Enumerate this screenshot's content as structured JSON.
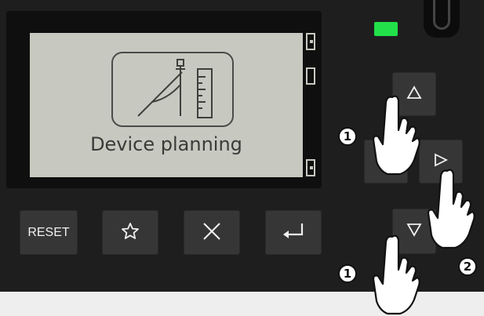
{
  "display": {
    "title": "Device planning",
    "icon": "device-planning-icon"
  },
  "keys": {
    "reset_label": "RESET",
    "favorite_icon": "star-icon",
    "cancel_icon": "close-icon",
    "enter_icon": "enter-icon",
    "up_icon": "triangle-up-icon",
    "right_icon": "triangle-right-icon",
    "down_icon": "triangle-down-icon"
  },
  "annotations": {
    "step_1": "1",
    "step_2": "2"
  },
  "colors": {
    "panel": "#1e1e1e",
    "lcd": "#c7c9c0",
    "led": "#22e04a",
    "key": "#363636"
  }
}
